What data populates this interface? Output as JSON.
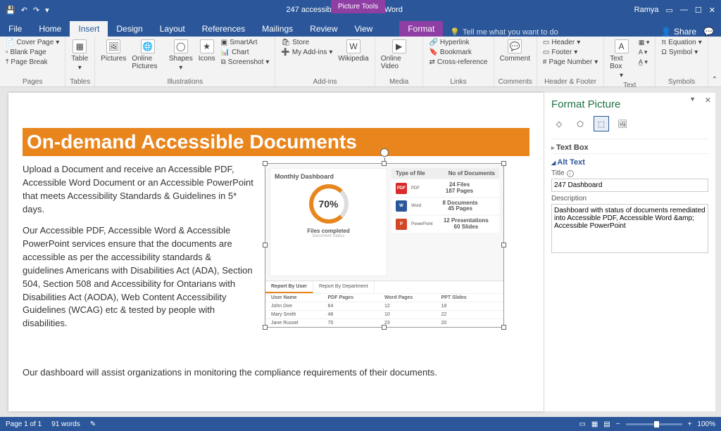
{
  "titlebar": {
    "doc_title": "247 accessible documents - Word",
    "user": "Ramya",
    "pictools": "Picture Tools"
  },
  "tabs": {
    "file": "File",
    "home": "Home",
    "insert": "Insert",
    "design": "Design",
    "layout": "Layout",
    "references": "References",
    "mailings": "Mailings",
    "review": "Review",
    "view": "View",
    "format": "Format",
    "tell": "Tell me what you want to do",
    "share": "Share"
  },
  "ribbon": {
    "pages": {
      "cover": "Cover Page",
      "blank": "Blank Page",
      "break": "Page Break",
      "label": "Pages"
    },
    "tables": {
      "table": "Table",
      "label": "Tables"
    },
    "illus": {
      "pictures": "Pictures",
      "online": "Online Pictures",
      "shapes": "Shapes",
      "icons": "Icons",
      "smartart": "SmartArt",
      "chart": "Chart",
      "screenshot": "Screenshot",
      "label": "Illustrations"
    },
    "addins": {
      "store": "Store",
      "myaddins": "My Add-ins",
      "wikipedia": "Wikipedia",
      "label": "Add-ins"
    },
    "media": {
      "video": "Online Video",
      "label": "Media"
    },
    "links": {
      "hyper": "Hyperlink",
      "bookmark": "Bookmark",
      "cross": "Cross-reference",
      "label": "Links"
    },
    "comments": {
      "comment": "Comment",
      "label": "Comments"
    },
    "hf": {
      "header": "Header",
      "footer": "Footer",
      "pagenum": "Page Number",
      "label": "Header & Footer"
    },
    "text": {
      "textbox": "Text Box",
      "label": "Text"
    },
    "symbols": {
      "equation": "Equation",
      "symbol": "Symbol",
      "label": "Symbols"
    }
  },
  "doc": {
    "heading": "On-demand Accessible Documents",
    "p1": "Upload a Document and receive an Accessible PDF, Accessible Word Document or an Accessible PowerPoint that meets Accessibility Standards & Guidelines in 5* days.",
    "p2": "Our Accessible PDF, Accessible Word & Accessible PowerPoint services ensure that the documents are accessible as per the accessibility standards & guidelines Americans with Disabilities Act (ADA), Section 504, Section 508 and Accessibility for Ontarians with Disabilities Act (AODA), Web Content Accessibility Guidelines (WCAG) etc & tested by people with disabilities.",
    "p3": "Our dashboard will assist organizations in monitoring the compliance requirements of their documents."
  },
  "dash": {
    "title": "Monthly Dashboard",
    "pct": "70%",
    "completed": "Files completed",
    "status": "Document Status",
    "type_h": "Type of file",
    "num_h": "No of Documents",
    "pdf": {
      "name": "PDF",
      "l1": "24 Files",
      "l2": "187 Pages"
    },
    "word": {
      "name": "Word",
      "l1": "8 Documents",
      "l2": "45 Pages"
    },
    "ppt": {
      "name": "PowerPoint",
      "l1": "12 Presentations",
      "l2": "60 Slides"
    },
    "tab1": "Report By User",
    "tab2": "Report By Department",
    "cols": {
      "c1": "User Name",
      "c2": "PDF Pages",
      "c3": "Word Pages",
      "c4": "PPT Slides"
    },
    "r1": {
      "c1": "John Doe",
      "c2": "64",
      "c3": "12",
      "c4": "18"
    },
    "r2": {
      "c1": "Mary Smith",
      "c2": "48",
      "c3": "10",
      "c4": "22"
    },
    "r3": {
      "c1": "Jane Russel",
      "c2": "75",
      "c3": "23",
      "c4": "20"
    }
  },
  "panel": {
    "title": "Format Picture",
    "textbox": "Text Box",
    "alttext": "Alt Text",
    "title_label": "Title",
    "title_value": "247 Dashboard",
    "desc_label": "Description",
    "desc_value": "Dashboard with status of documents remediated into Accessible PDF, Accessible Word &amp; Accessible PowerPoint"
  },
  "status": {
    "page": "Page 1 of 1",
    "words": "91 words",
    "zoom": "100%"
  },
  "chart_data": {
    "type": "table",
    "title": "Monthly Dashboard",
    "donut_percent": 70,
    "file_types": [
      {
        "type": "PDF",
        "files": 24,
        "pages": 187
      },
      {
        "type": "Word",
        "documents": 8,
        "pages": 45
      },
      {
        "type": "PowerPoint",
        "presentations": 12,
        "slides": 60
      }
    ],
    "columns": [
      "User Name",
      "PDF Pages",
      "Word Pages",
      "PPT Slides"
    ],
    "rows": [
      [
        "John Doe",
        64,
        12,
        18
      ],
      [
        "Mary Smith",
        48,
        10,
        22
      ],
      [
        "Jane Russel",
        75,
        23,
        20
      ]
    ]
  }
}
